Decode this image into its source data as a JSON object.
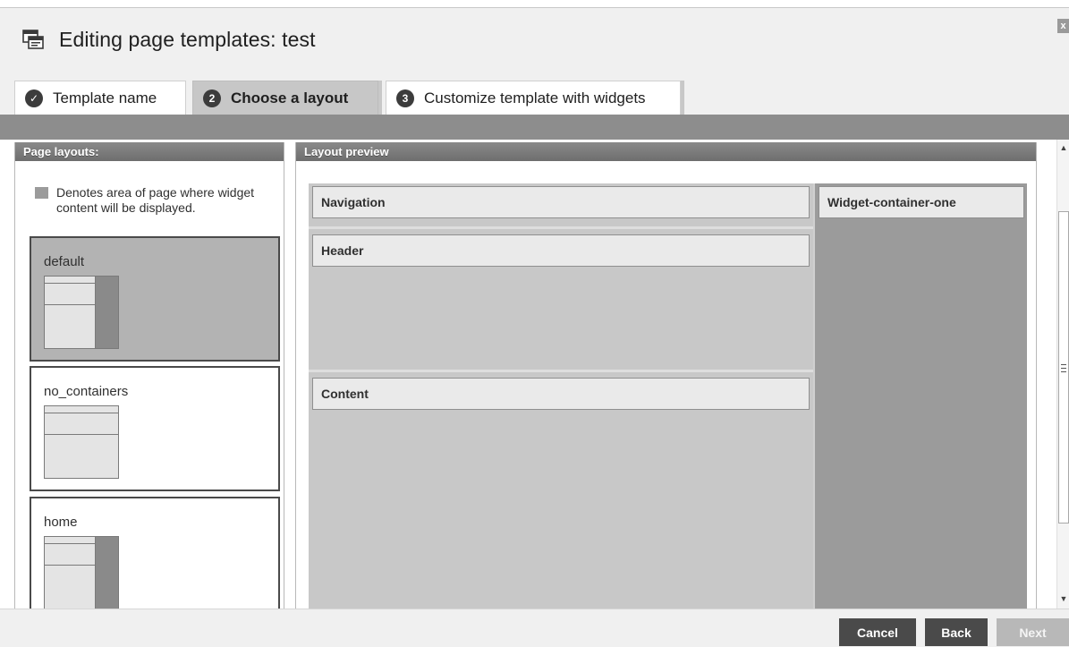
{
  "window": {
    "title": "Editing page templates: test",
    "close_label": "x"
  },
  "tabs": [
    {
      "badge": "✓",
      "label": "Template name",
      "state": "completed"
    },
    {
      "badge": "2",
      "label": "Choose a layout",
      "state": "active"
    },
    {
      "badge": "3",
      "label": "Customize template with widgets",
      "state": "upcoming"
    }
  ],
  "left_panel": {
    "header": "Page layouts:",
    "legend_text": "Denotes area of page where widget content will be displayed.",
    "layouts": [
      {
        "name": "default",
        "selected": true,
        "has_sidebar": true
      },
      {
        "name": "no_containers",
        "selected": false,
        "has_sidebar": false
      },
      {
        "name": "home",
        "selected": false,
        "has_sidebar": true
      }
    ]
  },
  "preview": {
    "header": "Layout preview",
    "regions": {
      "navigation": "Navigation",
      "header": "Header",
      "content": "Content",
      "sidebar": "Widget-container-one"
    }
  },
  "footer": {
    "cancel_label": "Cancel",
    "back_label": "Back",
    "next_label": "Next"
  }
}
